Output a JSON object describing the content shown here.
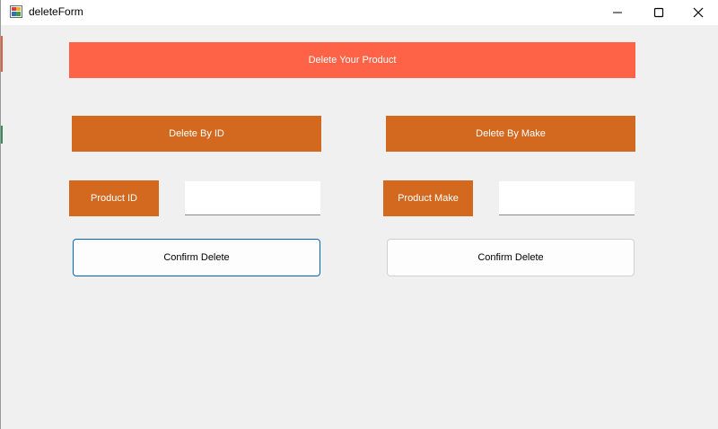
{
  "window": {
    "title": "deleteForm",
    "controls": {
      "minimize_icon": "minimize-icon",
      "maximize_icon": "maximize-icon",
      "close_icon": "close-icon"
    }
  },
  "banner": {
    "label": "Delete Your Product",
    "color": "#ff6347"
  },
  "delete_by_id": {
    "header": "Delete By ID",
    "field_label": "Product ID",
    "input_value": "",
    "confirm_label": "Confirm Delete"
  },
  "delete_by_make": {
    "header": "Delete By Make",
    "field_label": "Product Make",
    "input_value": "",
    "confirm_label": "Confirm Delete"
  },
  "colors": {
    "section_accent": "#d2691e",
    "background": "#f0f0f0",
    "focus_border": "#0067c0"
  }
}
